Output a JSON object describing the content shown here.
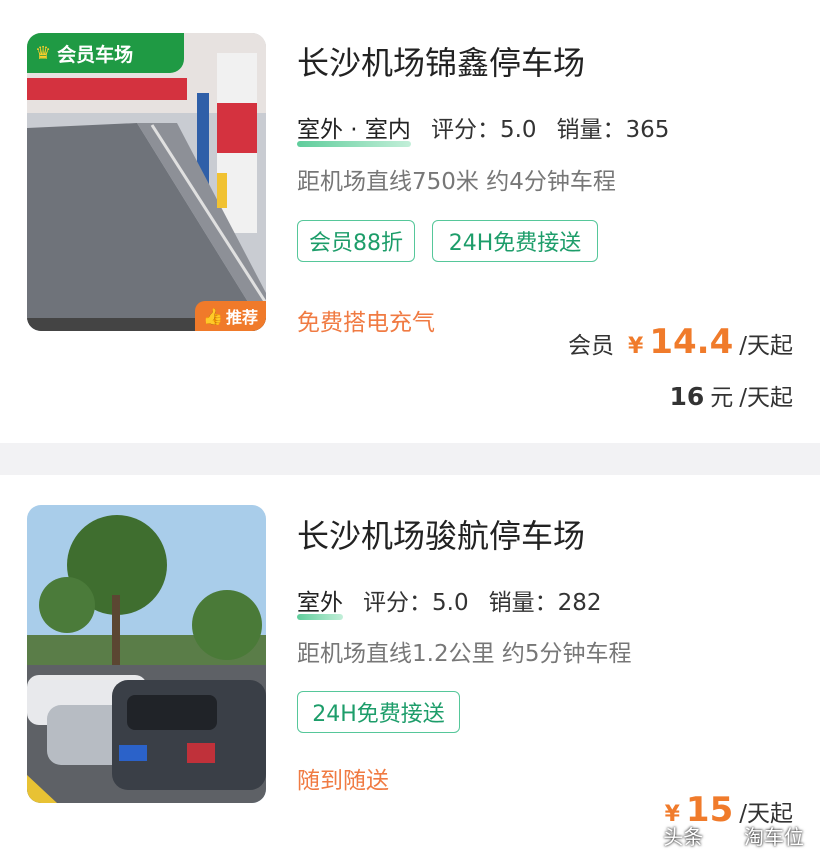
{
  "cards": [
    {
      "member_badge": "会员车场",
      "recommend_badge": "推荐",
      "title": "长沙机场锦鑫停车场",
      "location": "室外 · 室内",
      "rating": "评分：5.0",
      "sales": "销量：365",
      "distance": "距机场直线750米 约4分钟车程",
      "tags": [
        "会员88折",
        "24H免费接送"
      ],
      "service": "免费搭电充气",
      "member_label": "会员",
      "currency": "¥",
      "member_price": "14.4",
      "per_day": "/天起",
      "regular_price": "16",
      "regular_unit": "元"
    },
    {
      "title": "长沙机场骏航停车场",
      "location": "室外",
      "rating": "评分：5.0",
      "sales": "销量：282",
      "distance": "距机场直线1.2公里 约5分钟车程",
      "tags": [
        "24H免费接送"
      ],
      "service": "随到随送",
      "currency": "¥",
      "price": "15",
      "per_day": "/天起"
    }
  ],
  "watermark": {
    "left": "头条",
    "right": "淘车位"
  },
  "colors": {
    "accent_orange": "#f07b2b",
    "tag_green": "#1d9d6a",
    "badge_green": "#1f9a44"
  }
}
